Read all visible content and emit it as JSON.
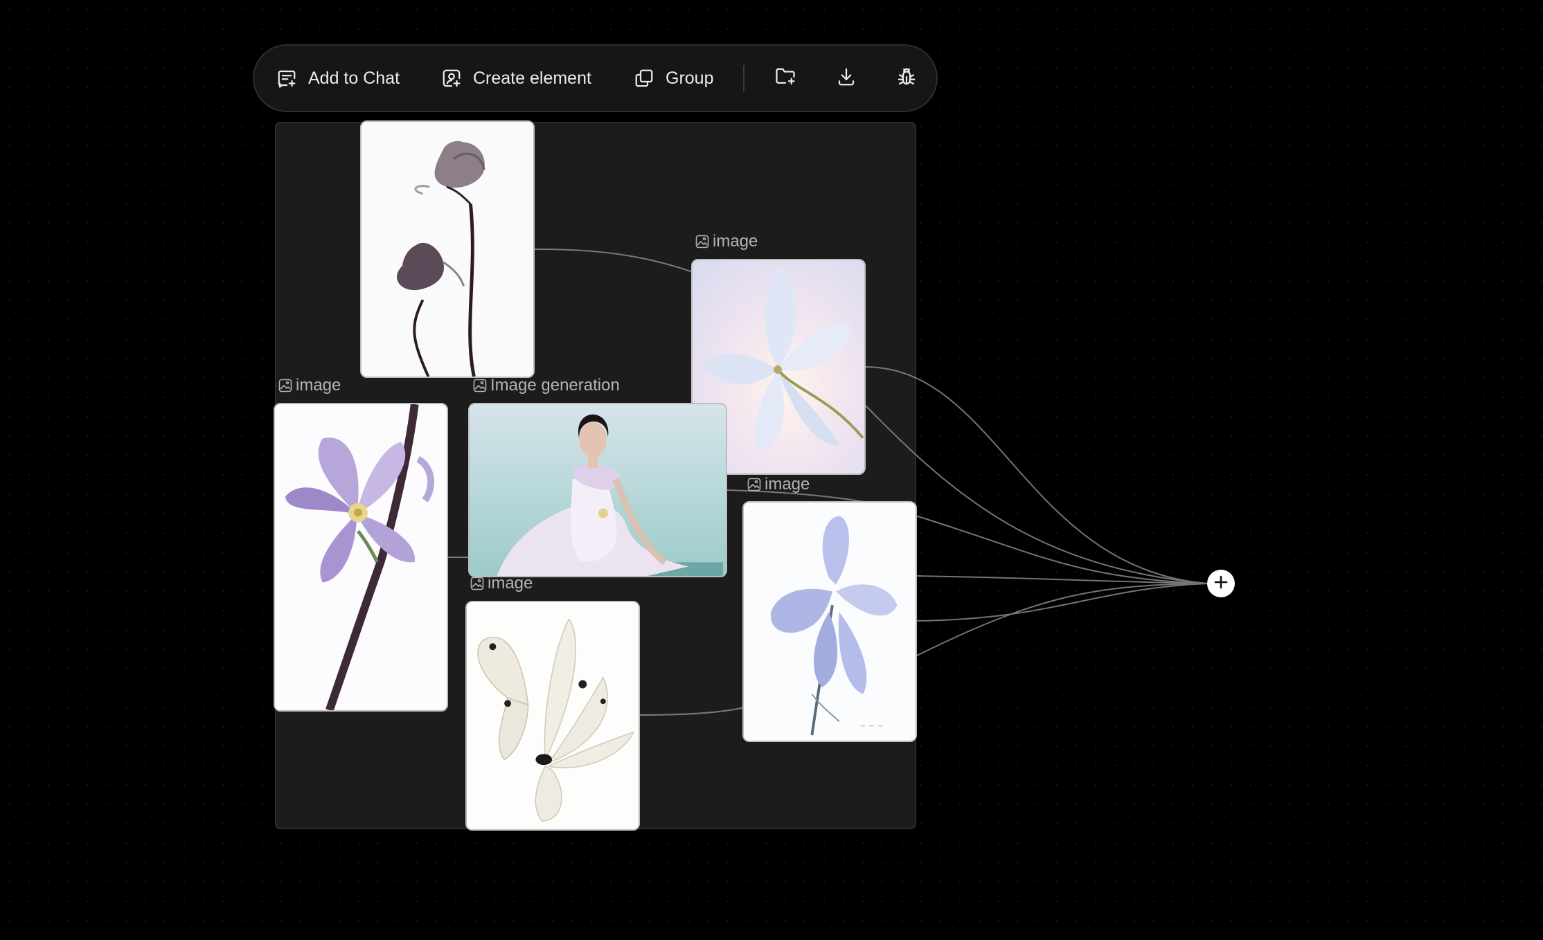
{
  "toolbar": {
    "add_to_chat_label": "Add to Chat",
    "create_element_label": "Create element",
    "group_label": "Group",
    "icons": [
      "chat-plus-icon",
      "create-element-icon",
      "group-icon",
      "folder-plus-icon",
      "download-icon",
      "bug-icon"
    ]
  },
  "nodes": {
    "tulip": {
      "label": "",
      "content": "tulip flower image"
    },
    "lily": {
      "label": "image"
    },
    "blossom": {
      "label": "image"
    },
    "generation": {
      "label": "Image generation"
    },
    "butterfly": {
      "label": "image"
    },
    "iris": {
      "label": "image"
    }
  },
  "colors": {
    "background": "#000000",
    "group_fill": "#1c1c1c",
    "toolbar_fill": "#161616",
    "edge": "#8a8a8a",
    "label_text": "#b4b4b4"
  }
}
